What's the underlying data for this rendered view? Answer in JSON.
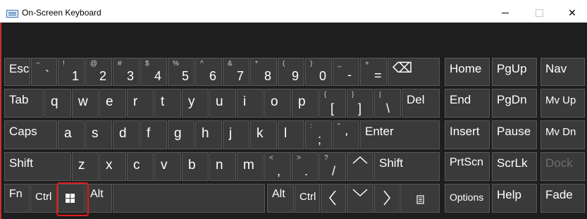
{
  "window": {
    "title": "On-Screen Keyboard",
    "minimize": "",
    "maximize": "",
    "close": "✕"
  },
  "keys": {
    "esc": "Esc",
    "backtick": {
      "shift": "~",
      "main": "`"
    },
    "n1": {
      "shift": "!",
      "main": "1"
    },
    "n2": {
      "shift": "@",
      "main": "2"
    },
    "n3": {
      "shift": "#",
      "main": "3"
    },
    "n4": {
      "shift": "$",
      "main": "4"
    },
    "n5": {
      "shift": "%",
      "main": "5"
    },
    "n6": {
      "shift": "^",
      "main": "6"
    },
    "n7": {
      "shift": "&",
      "main": "7"
    },
    "n8": {
      "shift": "*",
      "main": "8"
    },
    "n9": {
      "shift": "(",
      "main": "9"
    },
    "n0": {
      "shift": ")",
      "main": "0"
    },
    "minus": {
      "shift": "_",
      "main": "-"
    },
    "equals": {
      "shift": "+",
      "main": "="
    },
    "backspace": "⌫",
    "home": "Home",
    "pgup": "PgUp",
    "nav": "Nav",
    "tab": "Tab",
    "q": "q",
    "w": "w",
    "e": "e",
    "r": "r",
    "t": "t",
    "y": "y",
    "u": "u",
    "i": "i",
    "o": "o",
    "p": "p",
    "lbracket": {
      "shift": "{",
      "main": "["
    },
    "rbracket": {
      "shift": "}",
      "main": "]"
    },
    "backslash": {
      "shift": "|",
      "main": "\\"
    },
    "del": "Del",
    "end": "End",
    "pgdn": "PgDn",
    "mvup": "Mv Up",
    "caps": "Caps",
    "a": "a",
    "s": "s",
    "d": "d",
    "f": "f",
    "g": "g",
    "h": "h",
    "j": "j",
    "k": "k",
    "l": "l",
    "semicolon": {
      "shift": ":",
      "main": ";"
    },
    "quote": {
      "shift": "\"",
      "main": "'"
    },
    "enter": "Enter",
    "insert": "Insert",
    "pause": "Pause",
    "mvdn": "Mv Dn",
    "lshift": "Shift",
    "z": "z",
    "x": "x",
    "c": "c",
    "v": "v",
    "b": "b",
    "n": "n",
    "m": "m",
    "comma": {
      "shift": "<",
      "main": ","
    },
    "period": {
      "shift": ">",
      "main": "."
    },
    "slash": {
      "shift": "?",
      "main": "/"
    },
    "up": "",
    "rshift": "Shift",
    "prtscn": "PrtScn",
    "scrlk": "ScrLk",
    "dock": "Dock",
    "fn": "Fn",
    "lctrl": "Ctrl",
    "lalt": "Alt",
    "ralt": "Alt",
    "rctrl": "Ctrl",
    "options": "Options",
    "help": "Help",
    "fade": "Fade"
  },
  "colors": {
    "keyboard_bg": "#1e1e1e",
    "key_bg": "#3a3a3a",
    "key_border": "#595959",
    "highlight": "#e0191d"
  }
}
